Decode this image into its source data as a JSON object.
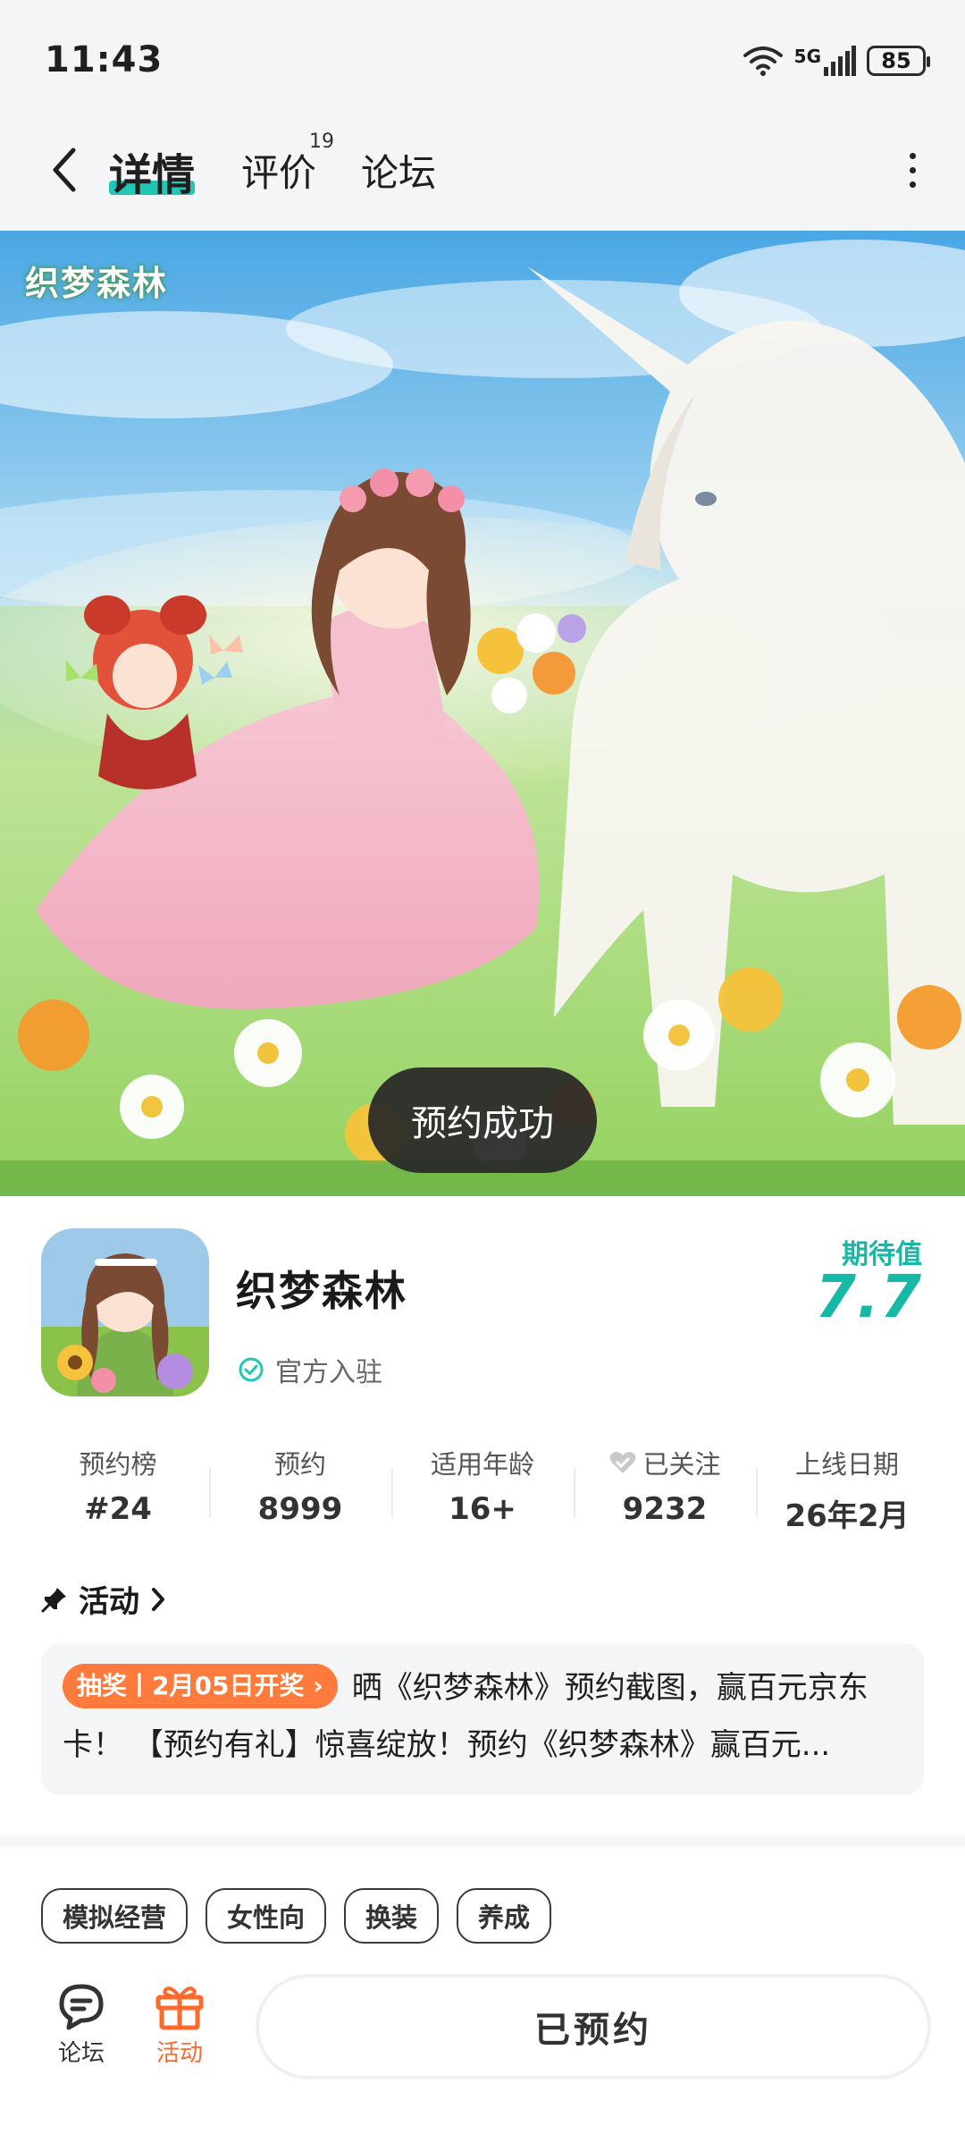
{
  "status_bar": {
    "time": "11:43",
    "network": "5G",
    "battery": "85"
  },
  "nav": {
    "tabs": [
      {
        "label": "详情",
        "active": true
      },
      {
        "label": "评价",
        "count": "19"
      },
      {
        "label": "论坛"
      }
    ]
  },
  "hero": {
    "logo_text": "织梦森林"
  },
  "toast": "预约成功",
  "game": {
    "title": "织梦森林",
    "verified": "官方入驻",
    "expect_label": "期待值",
    "expect_value": "7.7"
  },
  "stats": [
    {
      "label": "预约榜",
      "value": "#24"
    },
    {
      "label": "预约",
      "value": "8999"
    },
    {
      "label": "适用年龄",
      "value": "16+"
    },
    {
      "label": "已关注",
      "value": "9232"
    },
    {
      "label": "上线日期",
      "value": "26年2月"
    }
  ],
  "activity": {
    "title": "活动",
    "tag": "抽奖丨2月05日开奖",
    "text": "晒《织梦森林》预约截图，赢百元京东卡！ 【预约有礼】惊喜绽放！预约《织梦森林》赢百元..."
  },
  "tags": [
    "模拟经营",
    "女性向",
    "换装",
    "养成"
  ],
  "bottom_bar": {
    "forum_label": "论坛",
    "activity_label": "活动",
    "reserve_button": "已预约"
  },
  "colors": {
    "accent": "#20c7b5",
    "expect": "#16b9a6",
    "orange": "#ff7a3d"
  }
}
